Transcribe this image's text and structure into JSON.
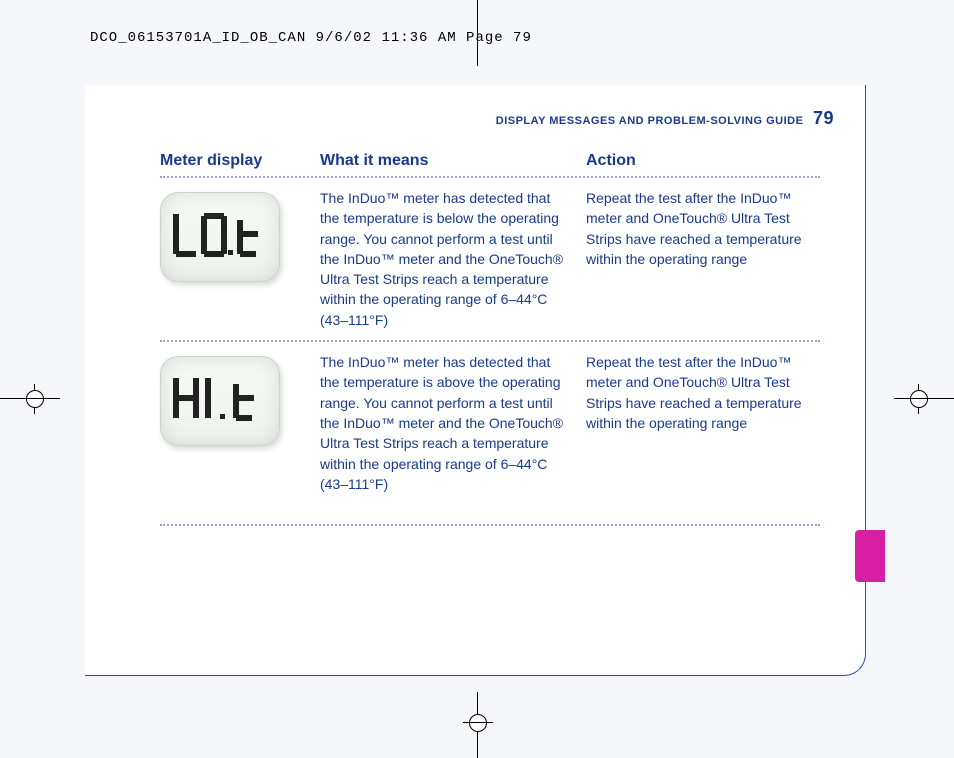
{
  "print_header": "DCO_06153701A_ID_OB_CAN  9/6/02  11:36 AM  Page 79",
  "running_head": "DISPLAY MESSAGES AND PROBLEM-SOLVING GUIDE",
  "page_number": "79",
  "columns": {
    "meter_display": "Meter display",
    "what_it_means": "What it means",
    "action": "Action"
  },
  "rows": [
    {
      "display_code": "LO.t",
      "what": "The InDuo™ meter has detected that the temperature is below the operating range. You cannot perform a test until the InDuo™ meter and the OneTouch® Ultra Test Strips reach a temperature within the operating range of 6–44°C (43–111°F)",
      "action": "Repeat the test after the InDuo™ meter and OneTouch® Ultra Test Strips have reached a temperature within the operating range"
    },
    {
      "display_code": "HI .t",
      "what": "The InDuo™ meter has detected that the temperature is above the operating range. You cannot perform a test until the InDuo™ meter and the OneTouch® Ultra Test Strips reach a temperature within the operating range of 6–44°C (43–111°F)",
      "action": "Repeat the test after the InDuo™ meter and OneTouch® Ultra Test Strips have reached a temperature within the operating range"
    }
  ]
}
